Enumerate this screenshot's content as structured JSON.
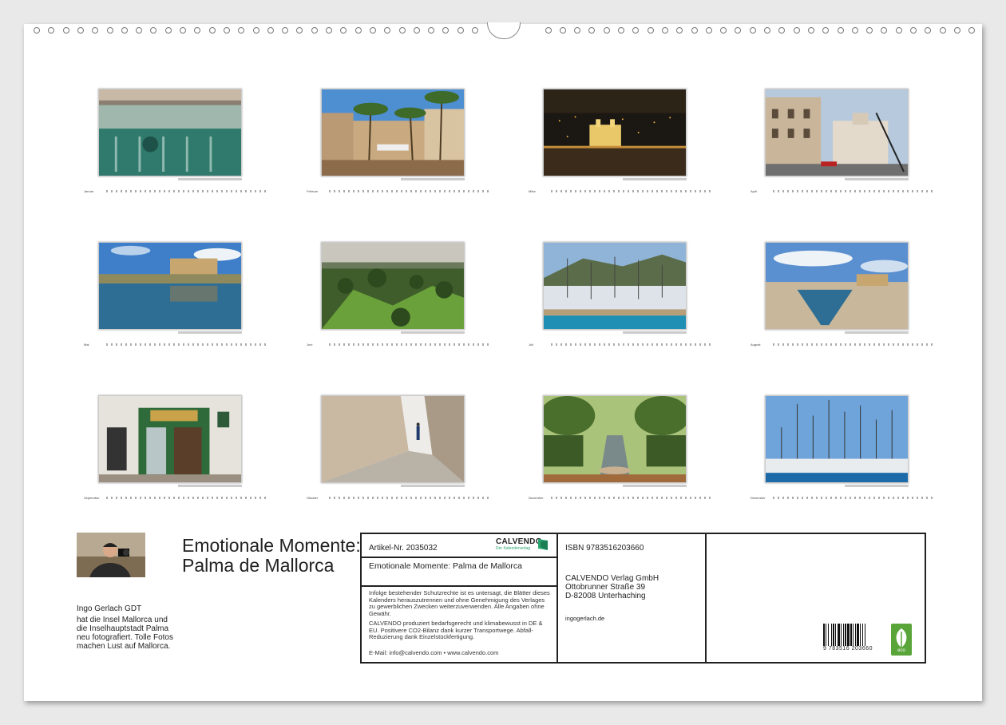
{
  "calendar": {
    "months": [
      {
        "label": "Januar"
      },
      {
        "label": "Februar"
      },
      {
        "label": "März"
      },
      {
        "label": "April"
      },
      {
        "label": "Mai"
      },
      {
        "label": "Juni"
      },
      {
        "label": "Juli"
      },
      {
        "label": "August"
      },
      {
        "label": "September"
      },
      {
        "label": "Oktober"
      },
      {
        "label": "November"
      },
      {
        "label": "Dezember"
      }
    ]
  },
  "back_cover": {
    "title": "Emotionale Momente: Palma de Mallorca",
    "author_name": "Ingo Gerlach GDT",
    "author_text": "hat die Insel Mallorca und die Inselhauptstadt Palma neu fotografiert. Tolle Fotos machen Lust auf Mallorca.",
    "article_no": "Artikel-Nr. 2035032",
    "product_title": "Emotionale Momente: Palma de Mallorca",
    "legal_text": "Infolge bestehender Schutzrechte ist es untersagt, die Blätter dieses Kalenders herauszutrennen und ohne Genehmigung des Verlages zu gewerblichen Zwecken weiterzuverwenden. Alle Angaben ohne Gewähr.",
    "eco_text": "CALVENDO produziert bedarfsgerecht und klimabewusst in DE & EU. Positivere CO2-Bilanz dank kurzer Transportwege. Abfall-Reduzierung dank Einzelstückfertigung.",
    "contact": "E-Mail: info@calvendo.com • www.calvendo.com",
    "logo_text": "CALVENDO",
    "logo_sub": "Der Kalenderverlag",
    "isbn": "ISBN 9783516203660",
    "publisher_name": "CALVENDO Verlag GmbH",
    "publisher_street": "Ottobrunner Straße 39",
    "publisher_city": "D-82008 Unterhaching",
    "author_site": "ingogerlach.de",
    "barcode_digits": "9 783516 203660",
    "eco_label": "eco"
  }
}
